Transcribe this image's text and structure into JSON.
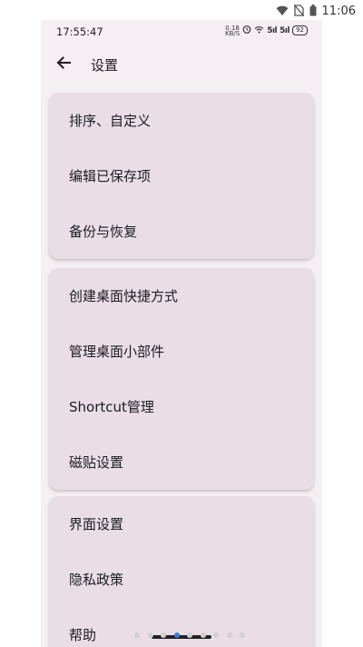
{
  "system": {
    "time": "11:06",
    "icons": [
      "wifi-icon",
      "sim-disabled-icon",
      "battery-icon"
    ]
  },
  "inner_status": {
    "time": "17:55:47",
    "net_speed_top": "0.18",
    "net_speed_bottom": "KB/S",
    "signal_1": "5ıl",
    "signal_2": "5ıl",
    "battery": "92"
  },
  "appbar": {
    "title": "设置",
    "back_icon": "arrow-left-icon"
  },
  "groups": [
    {
      "items": [
        "排序、自定义",
        "编辑已保存项",
        "备份与恢复"
      ]
    },
    {
      "items": [
        "创建桌面快捷方式",
        "管理桌面小部件",
        "Shortcut管理",
        "磁贴设置"
      ]
    },
    {
      "items": [
        "界面设置",
        "隐私政策",
        "帮助"
      ]
    }
  ],
  "pager": {
    "count": 9,
    "active_index": 3
  },
  "colors": {
    "background": "#f5eef3",
    "card": "#e9dde6",
    "text": "#1d1b20",
    "active_dot": "#3a7bd5"
  }
}
